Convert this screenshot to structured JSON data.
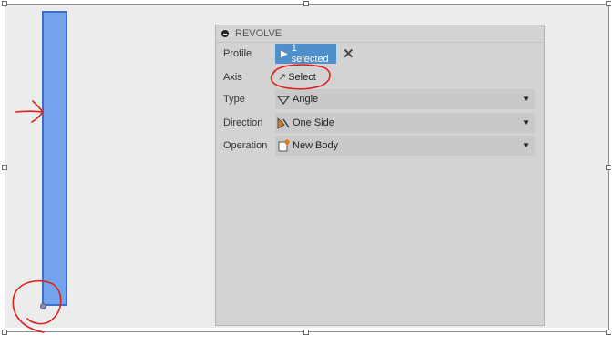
{
  "panel": {
    "title": "REVOLVE",
    "rows": {
      "profile": {
        "label": "Profile",
        "value": "1 selected"
      },
      "axis": {
        "label": "Axis",
        "value": "Select"
      },
      "type": {
        "label": "Type",
        "value": "Angle",
        "icon": "angle-icon"
      },
      "direction": {
        "label": "Direction",
        "value": "One Side",
        "icon": "one-side-icon"
      },
      "operation": {
        "label": "Operation",
        "value": "New Body",
        "icon": "new-body-icon"
      }
    }
  },
  "colors": {
    "accent": "#4f8fca",
    "sketch_fill": "#75a4ef",
    "sketch_edge": "#3f6fcc",
    "annotation": "#e0201a",
    "panel_bg": "#d3d3d3"
  }
}
